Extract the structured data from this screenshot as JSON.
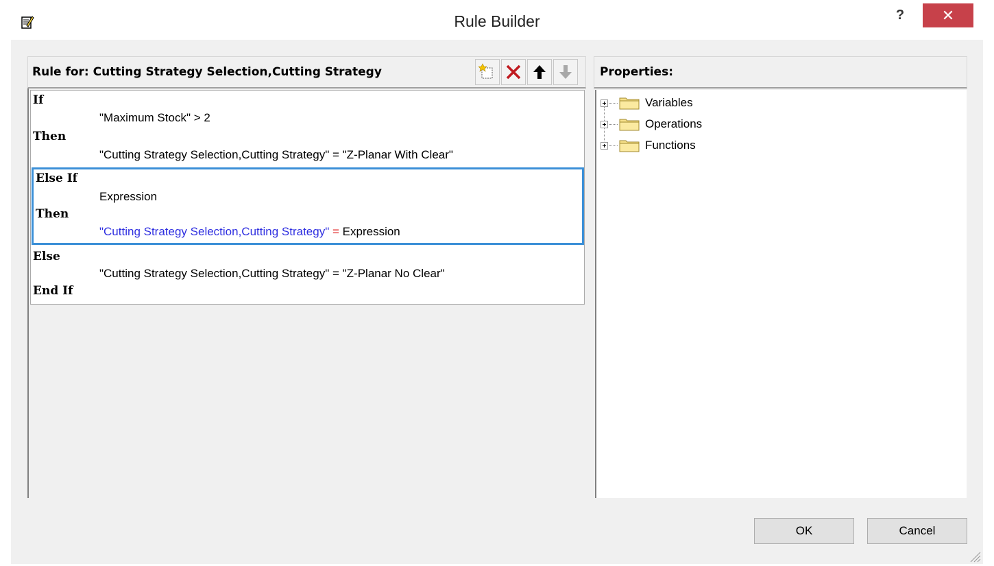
{
  "window": {
    "title": "Rule Builder",
    "help_label": "?",
    "close_label": "✕"
  },
  "left_panel": {
    "title": "Rule for: Cutting Strategy Selection,Cutting Strategy",
    "toolbar": [
      "new-rule-icon",
      "delete-icon",
      "move-up-icon",
      "move-down-icon"
    ]
  },
  "rule": {
    "if_kw": "If",
    "if_cond": "\"Maximum Stock\" > 2",
    "then1_kw": "Then",
    "then1_stmt": "\"Cutting Strategy Selection,Cutting Strategy\" = \"Z-Planar With Clear\"",
    "elseif_kw": "Else If",
    "elseif_cond": "Expression",
    "then2_kw": "Then",
    "then2_target": "\"Cutting Strategy Selection,Cutting Strategy\"",
    "then2_op": "=",
    "then2_value": "Expression",
    "else_kw": "Else",
    "else_stmt": "\"Cutting Strategy Selection,Cutting Strategy\" = \"Z-Planar No Clear\"",
    "endif_kw": "End If"
  },
  "right_panel": {
    "title": "Properties:",
    "tree": [
      {
        "label": "Variables",
        "icon": "folder-icon"
      },
      {
        "label": "Operations",
        "icon": "folder-icon"
      },
      {
        "label": "Functions",
        "icon": "folder-icon"
      }
    ]
  },
  "buttons": {
    "ok": "OK",
    "cancel": "Cancel"
  },
  "colors": {
    "selection_border": "#3b8fd7",
    "variable_blue": "#2f2fe0",
    "operator_red": "#e02020",
    "close_red": "#c7414a"
  }
}
